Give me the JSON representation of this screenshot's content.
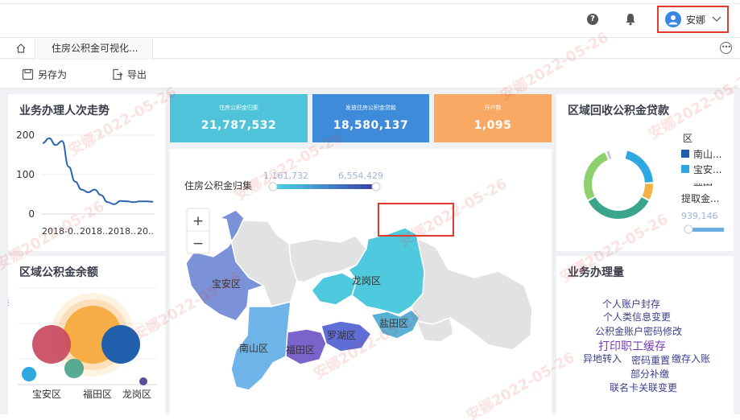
{
  "header": {
    "user_name": "安娜",
    "icons": {
      "help": "help-circle-icon",
      "notify": "bell-icon",
      "avatar": "user-avatar-icon",
      "dropdown": "chevron-down-icon"
    }
  },
  "tabs": {
    "current": "住房公积金可视化..."
  },
  "toolbar": {
    "save_as": "另存为",
    "export": "导出"
  },
  "kpis": [
    {
      "label": "住房公积金归集",
      "value": "21,787,532",
      "color": "#4fc3d9"
    },
    {
      "label": "发放住房公积金贷款",
      "value": "18,580,137",
      "color": "#3d8bd9"
    },
    {
      "label": "开户数",
      "value": "1,095",
      "color": "#f8aa64"
    }
  ],
  "trend": {
    "title": "业务办理人次走势",
    "y_ticks": [
      "200",
      "100",
      "0"
    ],
    "x_ticks": [
      "2018-0..",
      "2018..",
      "2018..",
      "20.."
    ]
  },
  "chart_data": [
    {
      "type": "line",
      "title": "业务办理人次走势",
      "ylim": [
        0,
        200
      ],
      "y": [
        180,
        192,
        175,
        185,
        120,
        82,
        62,
        55,
        62,
        48,
        30,
        25,
        33,
        32,
        30,
        32,
        32,
        31
      ],
      "x_ticks": [
        "2018-0..",
        "2018..",
        "2018..",
        "20.."
      ]
    },
    {
      "type": "scatter",
      "title": "区域公积金余额",
      "categories": [
        "宝安区",
        "福田区",
        "龙岗区"
      ]
    },
    {
      "type": "pie",
      "title": "区域回收公积金贷款"
    }
  ],
  "balance": {
    "title": "区域公积金余额",
    "x_labels": [
      "宝安区",
      "福田区",
      "龙岗区"
    ]
  },
  "map": {
    "legend_title": "住房公积金归集",
    "legend_min": "1,161,732",
    "legend_max": "6,554,429",
    "zoom_in": "+",
    "zoom_out": "−",
    "districts": [
      "宝安区",
      "龙岗区",
      "南山区",
      "福田区",
      "罗湖区",
      "盐田区"
    ]
  },
  "recovery": {
    "title": "区域回收公积金贷款",
    "legend_header": "区",
    "legend_items": [
      "南山...",
      "宝安...",
      "盐田"
    ],
    "legend_colors": [
      "#1f5fae",
      "#2ea8e0",
      "#f2b344"
    ],
    "extra_label": "提取金...",
    "extra_value": "939,146"
  },
  "volume": {
    "title": "业务办理量",
    "words": [
      "个人账户封存",
      "个人类信息变更",
      "公积金账户密码修改",
      "打印职工缓存",
      "异地转入",
      "密码重置",
      "缴存入账",
      "部分补缴",
      "联名卡关联变更"
    ]
  },
  "watermark": "安娜2022-05-26"
}
